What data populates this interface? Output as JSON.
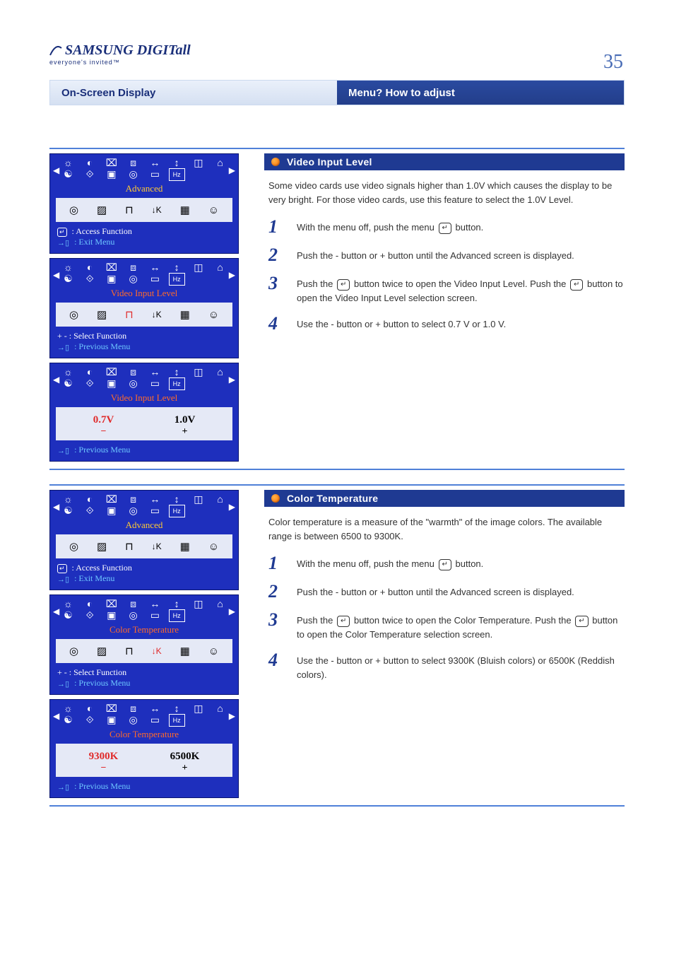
{
  "header": {
    "logo_main": "SAMSUNG DIGITall",
    "logo_tag": "everyone's invited™",
    "page_number": "35"
  },
  "topbar": {
    "left": "On-Screen Display",
    "right": "Menu? How to adjust"
  },
  "sections": [
    {
      "feature_title": "Video Input Level",
      "description": "Some video cards use video signals higher than 1.0V which causes the display to be very bright. For those video cards, use this feature to select the 1.0V Level.",
      "steps": [
        "With the menu off, push the menu",
        "Push the - button or + button until the Advanced screen is displayed.",
        "button to open the Video Input Level selection screen.",
        "Use the - button or + button to select 0.7 V or 1.0 V."
      ],
      "step3_prefix": "Push the",
      "step3_mid": "button twice to open the Video Input Level. Push the",
      "step_suffix_button": "button.",
      "osd1": {
        "title": "Advanced",
        "hint1": ": Access Function",
        "hint2": ": Exit Menu"
      },
      "osd2": {
        "title": "Video Input Level",
        "hint1": "+ - : Select Function",
        "hint2": ": Previous Menu"
      },
      "osd3": {
        "title": "Video Input Level",
        "options": [
          "0.7V",
          "1.0V"
        ],
        "selected": 0,
        "hint2": ": Previous Menu"
      }
    },
    {
      "feature_title": "Color Temperature",
      "description": "Color temperature is a measure of the \"warmth\" of the image colors. The available range is between 6500 to 9300K.",
      "steps": [
        "With the menu off, push the menu",
        "Push the - button or + button until the Advanced screen is displayed.",
        "button to open the Color Temperature selection screen.",
        "Use the - button or + button to select 9300K (Bluish colors) or 6500K (Reddish colors)."
      ],
      "step3_prefix": "Push the",
      "step3_mid": "button twice to open the Color Temperature. Push the",
      "step_suffix_button": "button.",
      "osd1": {
        "title": "Advanced",
        "hint1": ": Access Function",
        "hint2": ": Exit Menu"
      },
      "osd2": {
        "title": "Color Temperature",
        "hint1": "+ - : Select Function",
        "hint2": ": Previous Menu"
      },
      "osd3": {
        "title": "Color Temperature",
        "options": [
          "9300K",
          "6500K"
        ],
        "selected": 0,
        "hint2": ": Previous Menu"
      }
    }
  ],
  "glyphs": {
    "enter": "↵"
  }
}
